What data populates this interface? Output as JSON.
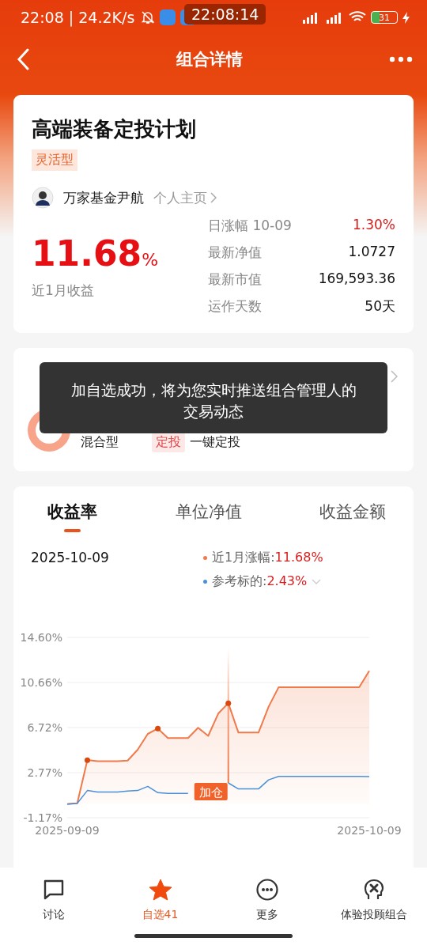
{
  "status_bar": {
    "left": "22:08 | 24.2K/s",
    "clock": "22:08:14",
    "battery": "31"
  },
  "nav": {
    "title": "组合详情"
  },
  "summary": {
    "title": "高端装备定投计划",
    "tag": "灵活型",
    "manager": "万家基金尹航",
    "manager_link": "个人主页",
    "return_value": "11.68",
    "return_unit": "%",
    "return_label": "近1月收益",
    "stats": [
      {
        "label": "日涨幅 10-09",
        "value": "1.30%",
        "kind": "rise"
      },
      {
        "label": "最新净值",
        "value": "1.0727",
        "kind": "plain"
      },
      {
        "label": "最新市值",
        "value": "169,593.36",
        "kind": "plain"
      },
      {
        "label": "运作天数",
        "value": "50天",
        "kind": "plain"
      }
    ]
  },
  "dynamics": {
    "pref_value": "混合型",
    "tag": "定投",
    "action": "一键定投"
  },
  "toast": {
    "text": "加自选成功，将为您实时推送组合管理人的交易动态"
  },
  "chart_card": {
    "tabs": [
      {
        "label": "收益率",
        "selected": true
      },
      {
        "label": "单位净值",
        "selected": false
      },
      {
        "label": "收益金额",
        "selected": false
      }
    ],
    "date": "2025-10-09",
    "legend": [
      {
        "value": "11.68%"
      },
      {
        "value": "2.43%"
      }
    ],
    "chart_data": {
      "type": "line",
      "grid": true,
      "categories": [
        "2025-09-09",
        null,
        null,
        null,
        null,
        null,
        null,
        null,
        null,
        null,
        null,
        null,
        null,
        null,
        null,
        null,
        null,
        null,
        null,
        null,
        null,
        null,
        null,
        null,
        null,
        null,
        null,
        null,
        null,
        null,
        "2025-10-09"
      ],
      "yticks": [
        {
          "value": -1.17,
          "label": "-1.17%"
        },
        {
          "value": 2.77,
          "label": "2.77%"
        },
        {
          "value": 6.72,
          "label": "6.72%"
        },
        {
          "value": 10.66,
          "label": "10.66%"
        },
        {
          "value": 14.6,
          "label": "14.60%"
        }
      ],
      "ylim": [
        -1.17,
        14.6
      ],
      "series": [
        {
          "name": "近1月涨幅:",
          "type": "area",
          "color": "#f07a4a",
          "values": [
            0.02,
            0.09,
            3.87,
            3.78,
            3.78,
            3.78,
            3.83,
            4.78,
            6.16,
            6.63,
            5.8,
            5.8,
            5.8,
            6.7,
            5.99,
            7.94,
            8.85,
            6.28,
            6.28,
            6.28,
            8.54,
            10.25,
            10.25,
            10.25,
            10.25,
            10.25,
            10.25,
            10.25,
            10.25,
            10.25,
            11.68
          ]
        },
        {
          "name": "参考标的:",
          "type": "line",
          "color": "#4a90d9",
          "values": [
            0.02,
            0.09,
            1.21,
            1.07,
            1.07,
            1.07,
            1.16,
            1.21,
            1.57,
            1.02,
            0.95,
            0.95,
            0.95,
            null,
            null,
            null,
            1.87,
            1.35,
            1.35,
            1.35,
            2.14,
            2.45,
            2.45,
            2.45,
            2.45,
            2.45,
            2.45,
            2.45,
            2.45,
            2.45,
            2.43
          ]
        },
        {
          "type": "scatter",
          "color": "#d9480f",
          "values": [
            null,
            null,
            3.87,
            null,
            null,
            null,
            null,
            null,
            null,
            6.63,
            null,
            null,
            null,
            null,
            null,
            null,
            8.85,
            null,
            null,
            null,
            null,
            null,
            null,
            null,
            null,
            null,
            null,
            null,
            null,
            null,
            null
          ]
        }
      ],
      "annotations": [
        {
          "text": "加仓"
        }
      ]
    }
  },
  "tabbar": [
    {
      "label": "讨论",
      "kind": "chat",
      "selected": false
    },
    {
      "label": "自选41",
      "kind": "star",
      "selected": true
    },
    {
      "label": "更多",
      "kind": "more",
      "selected": false
    },
    {
      "label": "体验投顾组合",
      "kind": "brain",
      "selected": false
    }
  ]
}
